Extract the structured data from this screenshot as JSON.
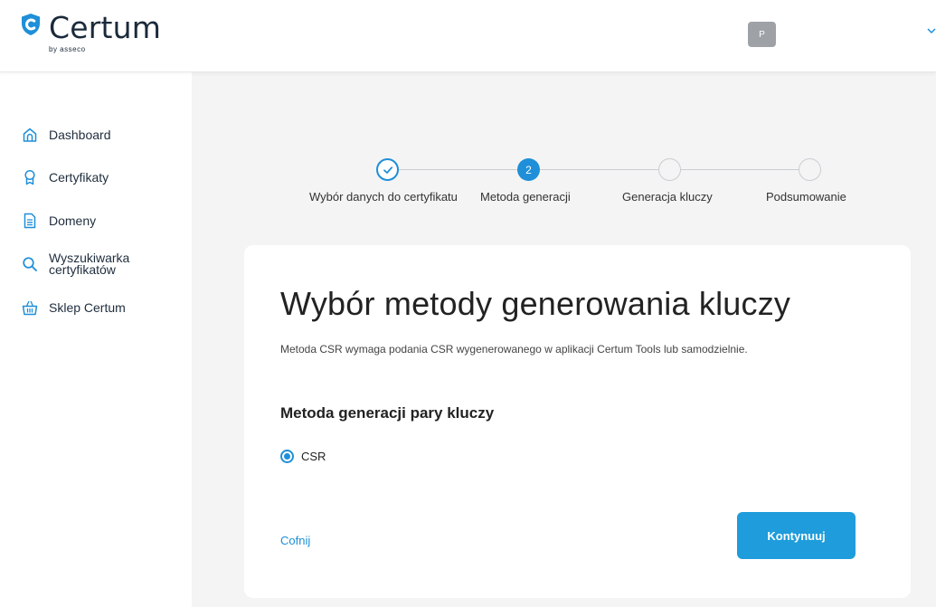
{
  "brand": {
    "name": "Certum",
    "sub": "by asseco",
    "colors": {
      "accent": "#1e8fd8",
      "button": "#1e9cdb",
      "text": "#1f2d3d",
      "background": "#f4f4f4"
    }
  },
  "header": {
    "avatar_initial": "P"
  },
  "sidebar": {
    "items": [
      {
        "label": "Dashboard",
        "icon": "home-icon"
      },
      {
        "label": "Certyfikaty",
        "icon": "certificate-icon"
      },
      {
        "label": "Domeny",
        "icon": "document-icon"
      },
      {
        "label": "Wyszukiwarka certyfikatów",
        "icon": "search-icon"
      },
      {
        "label": "Sklep Certum",
        "icon": "basket-icon"
      }
    ]
  },
  "stepper": {
    "current_step": 2,
    "steps": [
      {
        "label": "Wybór danych do certyfikatu",
        "status": "done",
        "marker": ""
      },
      {
        "label": "Metoda generacji",
        "status": "active",
        "marker": "2"
      },
      {
        "label": "Generacja kluczy",
        "status": "todo",
        "marker": ""
      },
      {
        "label": "Podsumowanie",
        "status": "todo",
        "marker": ""
      }
    ]
  },
  "card": {
    "title": "Wybór metody generowania kluczy",
    "description": "Metoda CSR wymaga podania CSR wygenerowanego w aplikacji Certum Tools lub samodzielnie.",
    "section_title": "Metoda generacji pary kluczy",
    "radio": {
      "label": "CSR",
      "selected": true
    },
    "back_label": "Cofnij",
    "continue_label": "Kontynuuj"
  }
}
